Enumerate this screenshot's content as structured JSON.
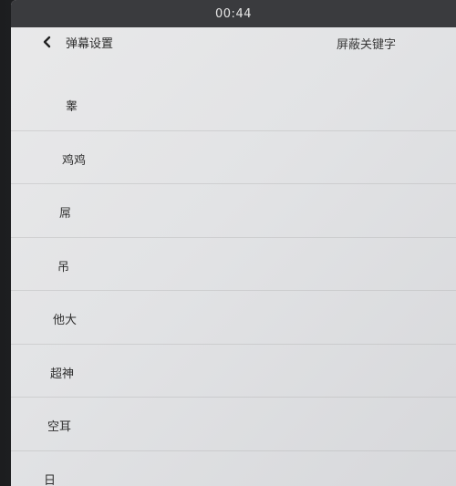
{
  "status_bar": {
    "time": "00:44"
  },
  "nav": {
    "back_label": "弹幕设置",
    "title": "屏蔽关键字"
  },
  "keywords": [
    "睾",
    "鸡鸡",
    "屌",
    "吊",
    "他大",
    "超神",
    "空耳",
    "日"
  ]
}
